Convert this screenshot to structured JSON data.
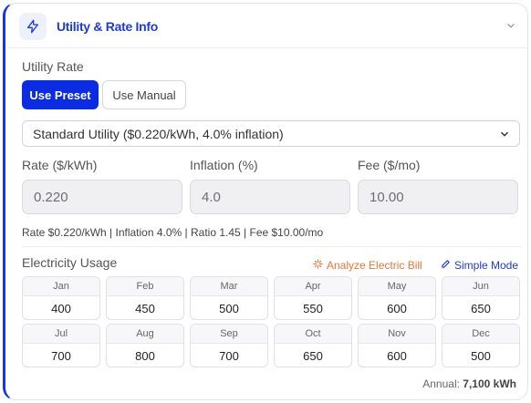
{
  "header": {
    "title": "Utility & Rate Info",
    "icon": "lightning-icon",
    "collapse_icon": "chevron-down-icon"
  },
  "utility_rate": {
    "label": "Utility Rate",
    "preset_button": "Use Preset",
    "manual_button": "Use Manual",
    "selected_option": "Standard Utility ($0.220/kWh, 4.0% inflation)"
  },
  "fields": {
    "rate": {
      "label": "Rate ($/kWh)",
      "value": "0.220"
    },
    "inflation": {
      "label": "Inflation (%)",
      "value": "4.0"
    },
    "fee": {
      "label": "Fee ($/mo)",
      "value": "10.00"
    }
  },
  "summary": "Rate $0.220/kWh | Inflation 4.0% | Ratio 1.45 | Fee $10.00/mo",
  "usage": {
    "label": "Electricity Usage",
    "analyze_link": "Analyze Electric Bill",
    "simple_link": "Simple Mode",
    "months": [
      {
        "name": "Jan",
        "value": "400"
      },
      {
        "name": "Feb",
        "value": "450"
      },
      {
        "name": "Mar",
        "value": "500"
      },
      {
        "name": "Apr",
        "value": "550"
      },
      {
        "name": "May",
        "value": "600"
      },
      {
        "name": "Jun",
        "value": "650"
      },
      {
        "name": "Jul",
        "value": "700"
      },
      {
        "name": "Aug",
        "value": "800"
      },
      {
        "name": "Sep",
        "value": "700"
      },
      {
        "name": "Oct",
        "value": "650"
      },
      {
        "name": "Nov",
        "value": "600"
      },
      {
        "name": "Dec",
        "value": "500"
      }
    ],
    "annual_label": "Annual:",
    "annual_value": "7,100 kWh"
  },
  "colors": {
    "accent": "#1536e6",
    "primary_button": "#0b2ce0",
    "analyze": "#e8773a"
  }
}
